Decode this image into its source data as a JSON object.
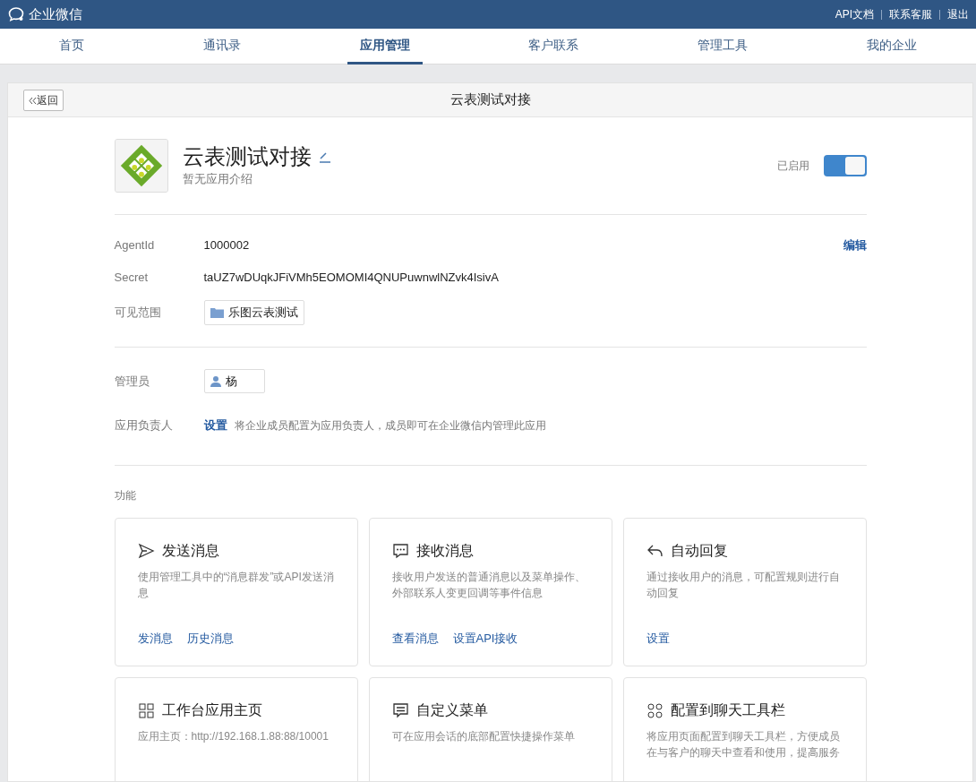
{
  "topbar": {
    "brand": "企业微信",
    "links": [
      "API文档",
      "联系客服",
      "退出"
    ]
  },
  "tabs": [
    {
      "label": "首页",
      "selected": false
    },
    {
      "label": "通讯录",
      "selected": false
    },
    {
      "label": "应用管理",
      "selected": true
    },
    {
      "label": "客户联系",
      "selected": false
    },
    {
      "label": "管理工具",
      "selected": false
    },
    {
      "label": "我的企业",
      "selected": false
    }
  ],
  "header": {
    "back": "返回",
    "title": "云表测试对接"
  },
  "app": {
    "name": "云表测试对接",
    "description": "暂无应用介绍",
    "status_label": "已启用",
    "enabled": true
  },
  "info": {
    "edit": "编辑",
    "rows": [
      {
        "kind": "text",
        "label": "AgentId",
        "value": "1000002"
      },
      {
        "kind": "text",
        "label": "Secret",
        "value": "taUZ7wDUqkJFiVMh5EOMOMI4QNUPuwnwlNZvk4IsivA"
      },
      {
        "kind": "department",
        "label": "可见范围",
        "value": "乐图云表测试"
      }
    ]
  },
  "admins": {
    "rows": [
      {
        "kind": "person",
        "label": "管理员",
        "value": "杨"
      },
      {
        "kind": "setting",
        "label": "应用负责人",
        "link": "设置",
        "hint": "将企业成员配置为应用负责人，成员即可在企业微信内管理此应用"
      }
    ]
  },
  "features": {
    "title": "功能",
    "cards": [
      {
        "kind": "send",
        "title": "发送消息",
        "description": "使用管理工具中的“消息群发”或API发送消息",
        "links": [
          "发消息",
          "历史消息"
        ]
      },
      {
        "kind": "chat",
        "title": "接收消息",
        "description": "接收用户发送的普通消息以及菜单操作、外部联系人变更回调等事件信息",
        "links": [
          "查看消息",
          "设置API接收"
        ]
      },
      {
        "kind": "reply",
        "title": "自动回复",
        "description": "通过接收用户的消息，可配置规则进行自动回复",
        "links": [
          "设置"
        ]
      },
      {
        "kind": "grid",
        "title": "工作台应用主页",
        "description": "应用主页：http://192.168.1.88:88/10001"
      },
      {
        "kind": "menu",
        "title": "自定义菜单",
        "description": "可在应用会话的底部配置快捷操作菜单"
      },
      {
        "kind": "tools",
        "title": "配置到聊天工具栏",
        "description": "将应用页面配置到聊天工具栏，方便成员在与客户的聊天中查看和使用，提高服务"
      }
    ]
  }
}
